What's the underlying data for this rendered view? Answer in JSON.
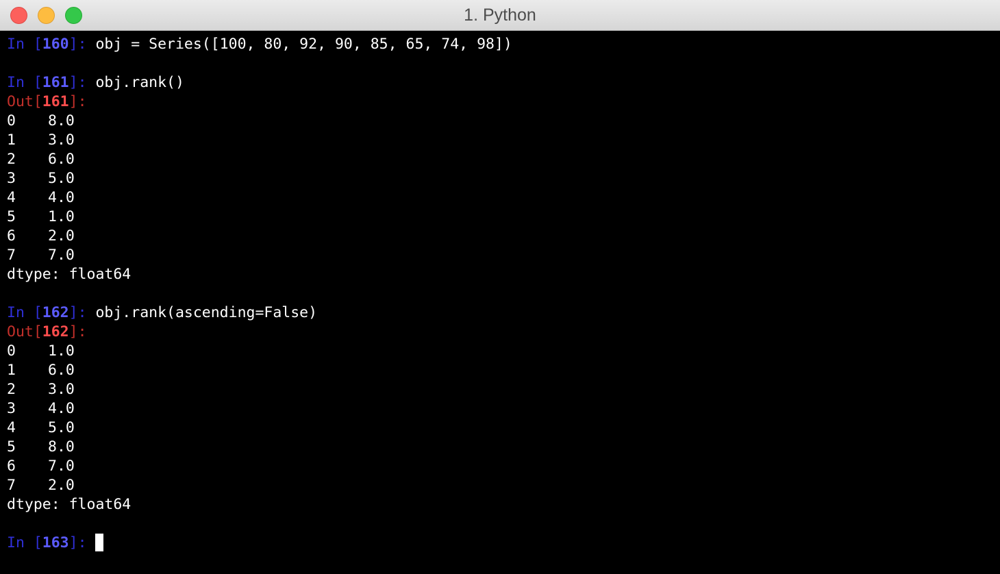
{
  "window": {
    "title": "1. Python"
  },
  "cells": [
    {
      "in_number": "160",
      "code": "obj = Series([100, 80, 92, 90, 85, 65, 74, 98])"
    },
    {
      "in_number": "161",
      "code": "obj.rank()",
      "out_number": "161",
      "rows": [
        {
          "index": "0",
          "value": "8.0"
        },
        {
          "index": "1",
          "value": "3.0"
        },
        {
          "index": "2",
          "value": "6.0"
        },
        {
          "index": "3",
          "value": "5.0"
        },
        {
          "index": "4",
          "value": "4.0"
        },
        {
          "index": "5",
          "value": "1.0"
        },
        {
          "index": "6",
          "value": "2.0"
        },
        {
          "index": "7",
          "value": "7.0"
        }
      ],
      "dtype": "dtype: float64"
    },
    {
      "in_number": "162",
      "code": "obj.rank(ascending=False)",
      "out_number": "162",
      "rows": [
        {
          "index": "0",
          "value": "1.0"
        },
        {
          "index": "1",
          "value": "6.0"
        },
        {
          "index": "2",
          "value": "3.0"
        },
        {
          "index": "3",
          "value": "4.0"
        },
        {
          "index": "4",
          "value": "5.0"
        },
        {
          "index": "5",
          "value": "8.0"
        },
        {
          "index": "6",
          "value": "7.0"
        },
        {
          "index": "7",
          "value": "2.0"
        }
      ],
      "dtype": "dtype: float64"
    },
    {
      "in_number": "163",
      "code": ""
    }
  ],
  "prompt": {
    "in_prefix": "In [",
    "out_prefix": "Out[",
    "suffix": "]: "
  },
  "colors": {
    "background": "#000000",
    "text": "#ffffff",
    "in_prompt": "#2f2fd6",
    "in_number": "#5b5bff",
    "out_prompt": "#c4302b",
    "out_number": "#ff4d4d"
  }
}
